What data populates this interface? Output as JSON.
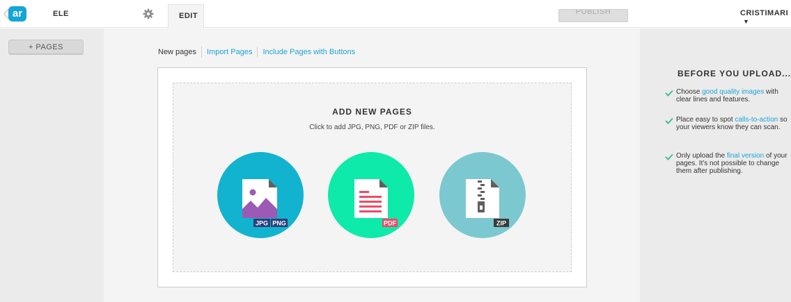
{
  "header": {
    "logo_text": "ar",
    "project_name": "ELE",
    "tab_edit": "EDIT",
    "publish_label": "PUBLISH",
    "user_name": "CRISTIMARI",
    "user_caret": "▼"
  },
  "sidebar": {
    "add_pages_label": "+ PAGES"
  },
  "subnav": {
    "items": [
      {
        "label": "New pages",
        "active": true
      },
      {
        "label": "Import Pages",
        "active": false
      },
      {
        "label": "Include Pages with Buttons",
        "active": false
      }
    ]
  },
  "upload": {
    "title": "ADD NEW PAGES",
    "subtitle": "Click to add JPG, PNG, PDF or ZIP files.",
    "types": [
      {
        "kind": "image",
        "badges": [
          "JPG",
          "PNG"
        ],
        "color": "#12b3cf"
      },
      {
        "kind": "pdf",
        "badges": [
          "PDF"
        ],
        "color": "#0eeaa9"
      },
      {
        "kind": "zip",
        "badges": [
          "ZIP"
        ],
        "color": "#7cc8d0"
      }
    ]
  },
  "tips": {
    "title": "BEFORE YOU UPLOAD...",
    "items": [
      {
        "before": "Choose ",
        "highlight": "good quality images",
        "after": " with clear lines and features."
      },
      {
        "before": "Place easy to spot ",
        "highlight": "calls-to-action",
        "after": " so your viewers know they can scan."
      },
      {
        "before": "Only upload the ",
        "highlight": "final version",
        "after": " of your pages. It's not possible to change them after publishing."
      }
    ]
  },
  "colors": {
    "accent_link": "#1ea3d3",
    "check_green": "#3fc08f",
    "logo_blue": "#13a6d6"
  }
}
